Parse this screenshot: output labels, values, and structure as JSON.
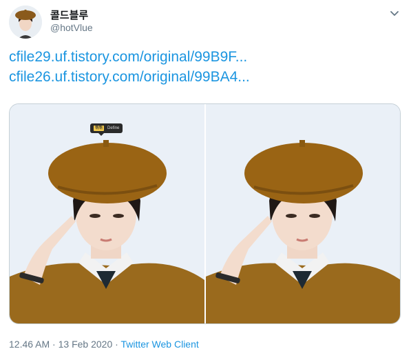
{
  "user": {
    "display_name": "콜드블루",
    "handle": "@hotVlue"
  },
  "menu": {
    "icon": "chevron-down-icon"
  },
  "links": [
    "cfile29.uf.tistory.com/original/99B9F...",
    "cfile26.uf.tistory.com/original/99BA4..."
  ],
  "media": {
    "popup": {
      "highlight": "뷔뷔",
      "action": "Define"
    }
  },
  "meta": {
    "time": "12.46 AM",
    "sep1": " · ",
    "date": "13 Feb 2020",
    "sep2": " · ",
    "source": "Twitter Web Client"
  },
  "colors": {
    "link": "#1b95e0",
    "muted": "#657786",
    "text": "#14171a"
  }
}
